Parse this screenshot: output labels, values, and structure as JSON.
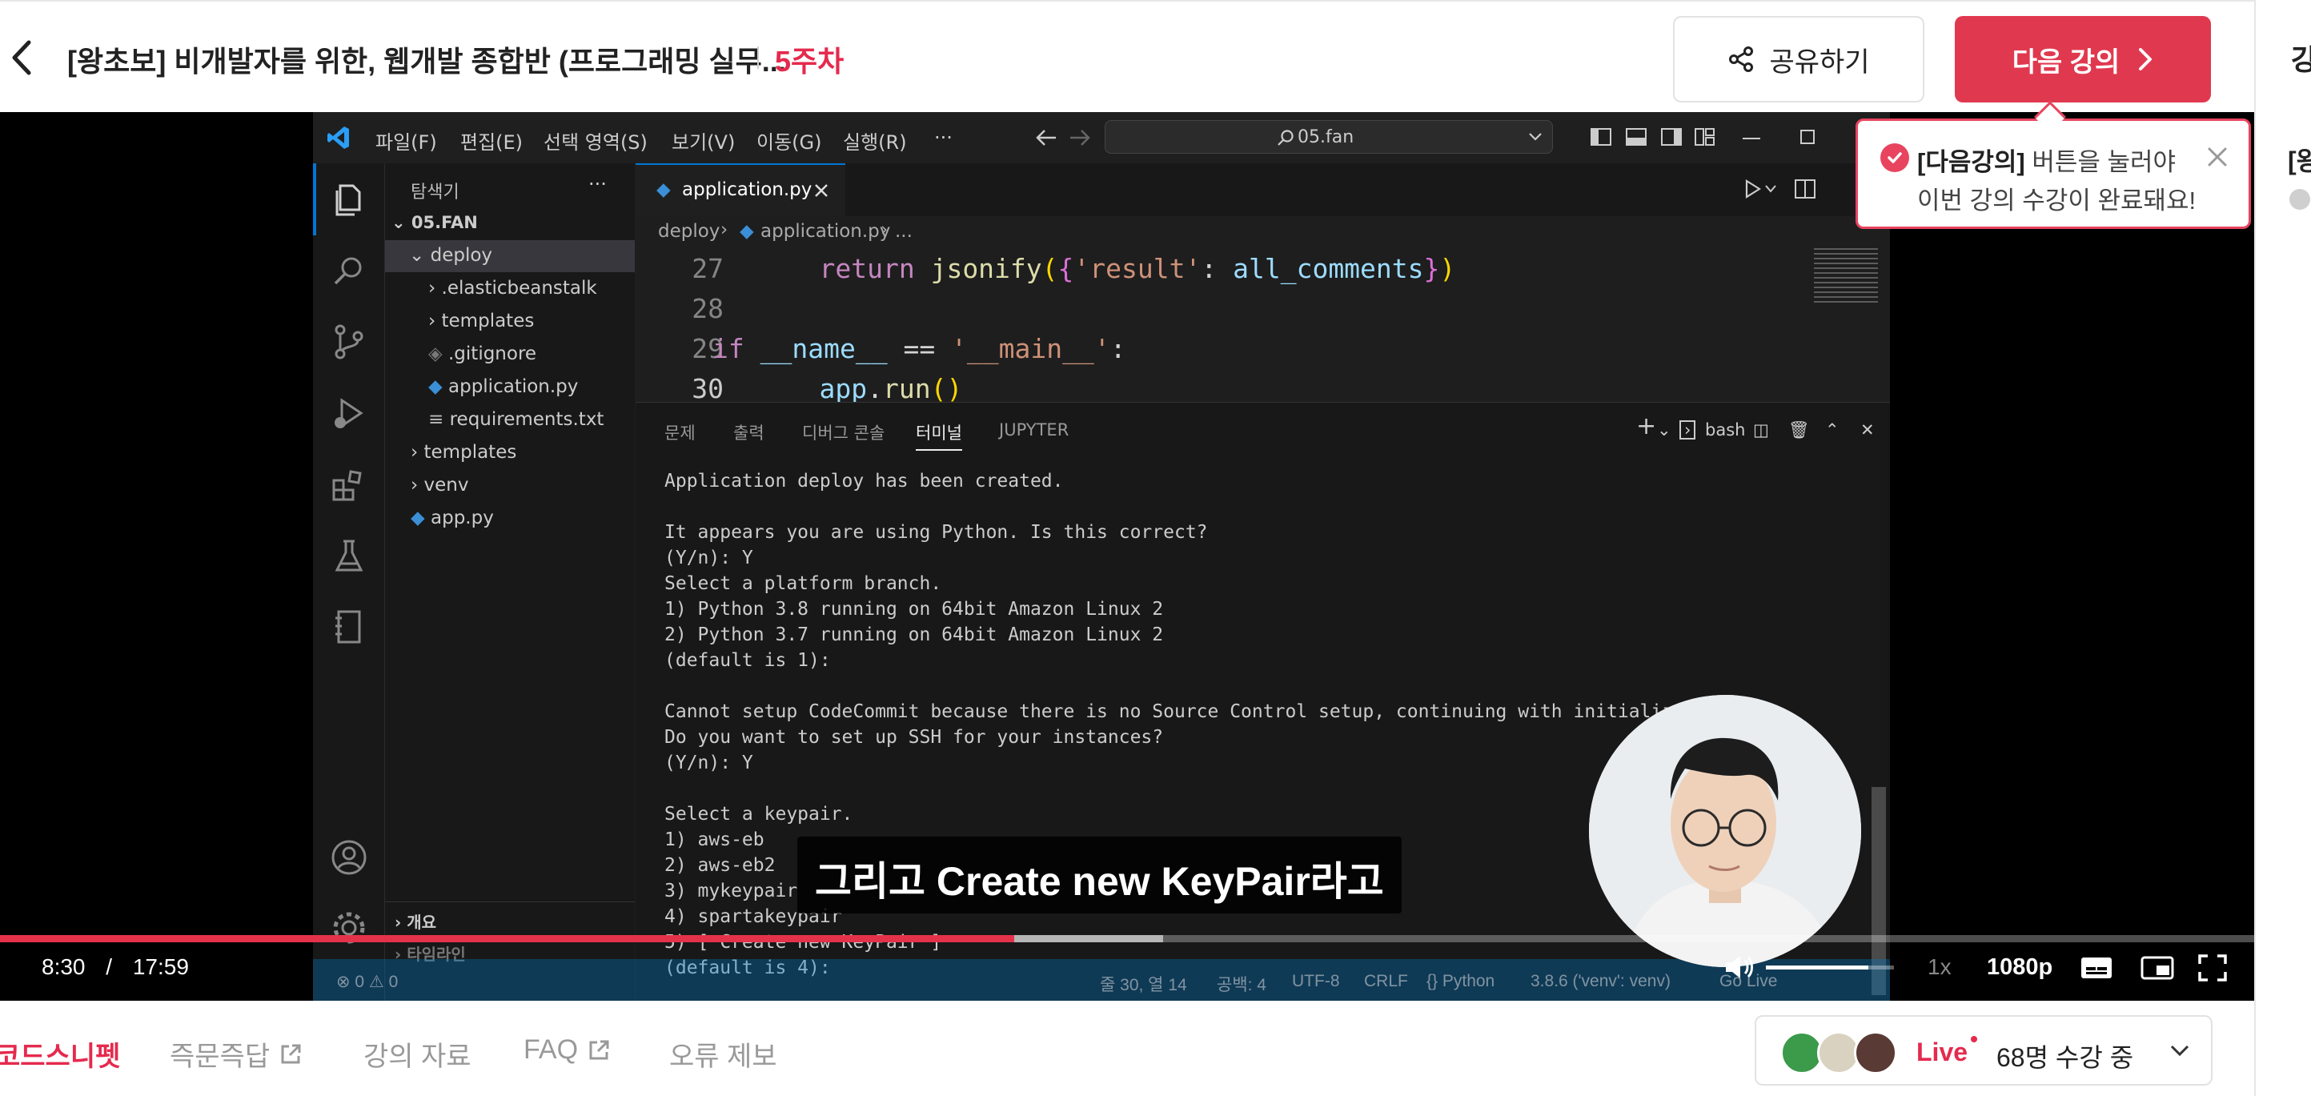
{
  "header": {
    "title": "[왕초보] 비개발자를 위한, 웹개발 종합반 (프로그래밍 실무...",
    "week": "5주차",
    "share_label": "공유하기",
    "next_label": "다음 강의",
    "right_clip_1": "강",
    "right_clip_2": "[왕"
  },
  "tooltip": {
    "highlight": "[다음강의]",
    "line1_rest": " 버튼을 눌러야",
    "line2": "이번 강의 수강이 완료돼요!"
  },
  "vscode": {
    "menus": [
      "파일(F)",
      "편집(E)",
      "선택 영역(S)",
      "보기(V)",
      "이동(G)",
      "실행(R)",
      "···"
    ],
    "search_text": "05.fan",
    "explorer_title": "탐색기",
    "explorer_more": "···",
    "root_folder": "05.FAN",
    "tree": [
      "deploy",
      ".elasticbeanstalk",
      "templates",
      ".gitignore",
      "application.py",
      "requirements.txt",
      "templates",
      "venv",
      "app.py"
    ],
    "outline_label": "개요",
    "timeline_label": "타임라인",
    "active_tab": "application.py",
    "breadcrumb": [
      "deploy",
      "application.py",
      "..."
    ],
    "code_lines": [
      {
        "num": "27",
        "text": "    return jsonify({'result': all_comments})"
      },
      {
        "num": "28",
        "text": ""
      },
      {
        "num": "29",
        "text": "if __name__ == '__main__':"
      },
      {
        "num": "30",
        "text": "    app.run()"
      }
    ],
    "panel_tabs": [
      "문제",
      "출력",
      "디버그 콘솔",
      "터미널",
      "JUPYTER"
    ],
    "shell_label": "bash",
    "terminal_lines": [
      "Application deploy has been created.",
      "",
      "It appears you are using Python. Is this correct?",
      "(Y/n): Y",
      "Select a platform branch.",
      "1) Python 3.8 running on 64bit Amazon Linux 2",
      "2) Python 3.7 running on 64bit Amazon Linux 2",
      "(default is 1):",
      "",
      "Cannot setup CodeCommit because there is no Source Control setup, continuing with initialization",
      "Do you want to set up SSH for your instances?",
      "(Y/n): Y",
      "",
      "Select a keypair.",
      "1) aws-eb",
      "2) aws-eb2",
      "3) mykeypair",
      "4) spartakeypair",
      "5) [ Create new KeyPair ]",
      "(default is 4):"
    ],
    "status_items": [
      "⊗ 0 ⚠ 0",
      "줄 30, 열 14",
      "공백: 4",
      "UTF-8",
      "CRLF",
      "{} Python",
      "3.8.6 ('venv': venv)",
      "Go Live"
    ]
  },
  "player": {
    "subtitle": "그리고 Create new KeyPair라고",
    "current_time": "8:30",
    "separator": "/",
    "duration": "17:59",
    "progress_played": 0.45,
    "progress_buffered": 0.516,
    "speed": "1x",
    "quality": "1080p",
    "volume_level": 0.8
  },
  "bottom": {
    "tabs": [
      "코드스니펫",
      "즉문즉답",
      "강의 자료",
      "FAQ",
      "오류 제보"
    ],
    "live_label": "Live",
    "live_count": "68명 수강 중"
  },
  "colors": {
    "accent": "#e52a4e",
    "vscode_blue": "#007acc"
  }
}
